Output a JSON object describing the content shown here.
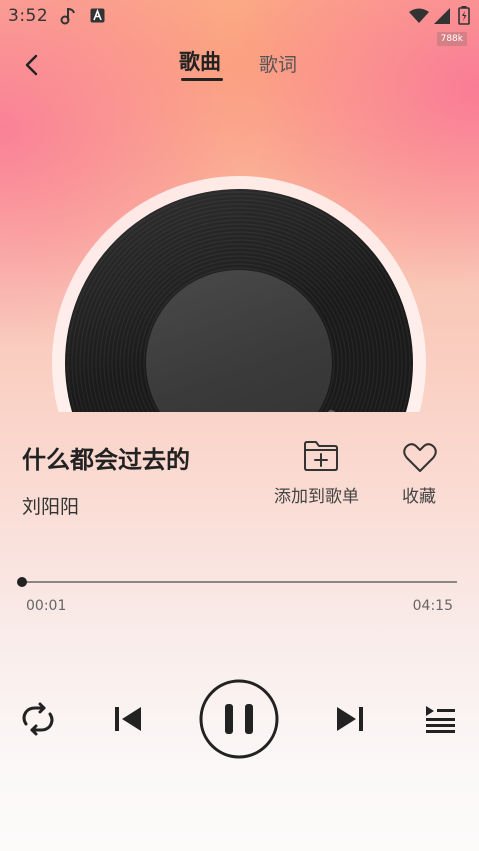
{
  "status_bar": {
    "time": "3:52",
    "speed": "788k",
    "icons": [
      "music-app-icon",
      "a-app-icon",
      "wifi-icon",
      "signal-icon",
      "battery-icon"
    ]
  },
  "header": {
    "back_icon": "chevron-left-icon",
    "tabs": [
      {
        "label": "歌曲",
        "active": true
      },
      {
        "label": "歌词",
        "active": false
      }
    ]
  },
  "disc": {
    "icon": "music-note-icon"
  },
  "song": {
    "title": "什么都会过去的",
    "artist": "刘阳阳"
  },
  "actions": {
    "add_to_playlist": "添加到歌单",
    "favorite": "收藏"
  },
  "progress": {
    "current": "00:01",
    "total": "04:15",
    "fraction": 0.004
  },
  "controls": {
    "repeat_icon": "repeat-icon",
    "prev_icon": "skip-previous-icon",
    "play_state": "playing",
    "pause_icon": "pause-icon",
    "next_icon": "skip-next-icon",
    "playlist_icon": "playlist-icon"
  },
  "colors": {
    "primary_text": "#222222",
    "gradient_top": "#f9b79f",
    "gradient_bottom": "#fcfbfa"
  }
}
